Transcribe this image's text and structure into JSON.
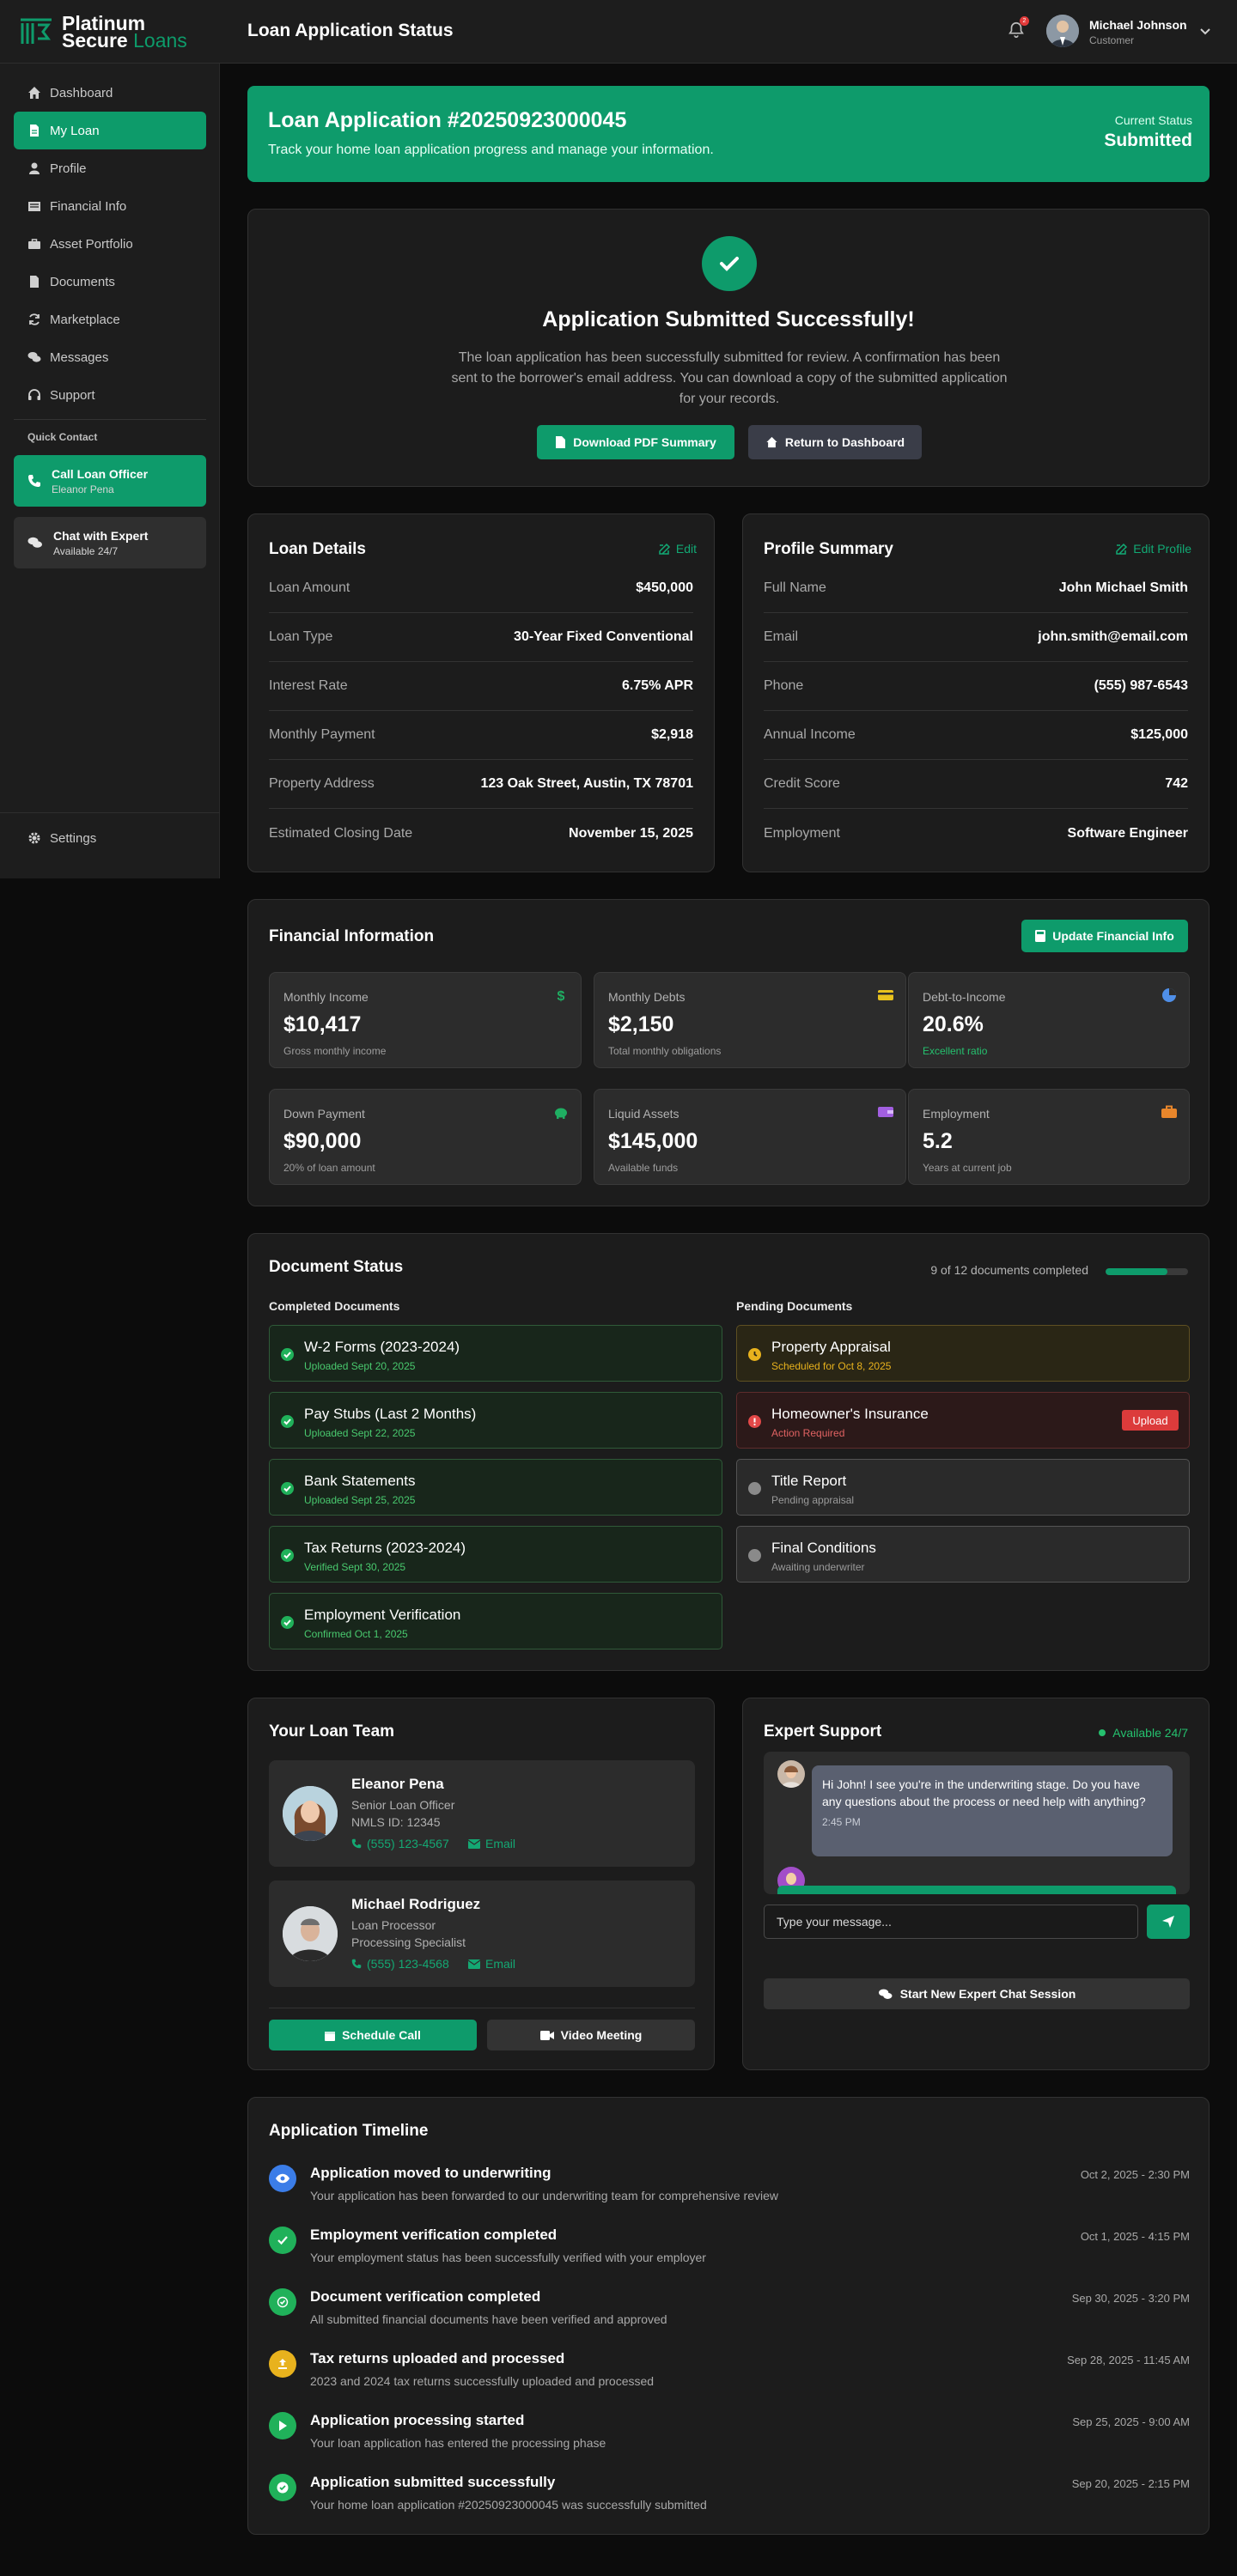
{
  "brand": {
    "line1": "Platinum",
    "line2a": "Secure",
    "line2b": "Loans",
    "accent": "#0e9b6b"
  },
  "header": {
    "title": "Loan Application Status",
    "notification_count": "2",
    "user_name": "Michael Johnson",
    "user_role": "Customer"
  },
  "sidebar": {
    "items": [
      {
        "label": "Dashboard",
        "icon": "home-icon"
      },
      {
        "label": "My Loan",
        "icon": "file-icon"
      },
      {
        "label": "Profile",
        "icon": "user-icon"
      },
      {
        "label": "Financial Info",
        "icon": "building-icon"
      },
      {
        "label": "Asset Portfolio",
        "icon": "briefcase-icon"
      },
      {
        "label": "Documents",
        "icon": "document-icon"
      },
      {
        "label": "Marketplace",
        "icon": "refresh-icon"
      },
      {
        "label": "Messages",
        "icon": "comments-icon"
      },
      {
        "label": "Support",
        "icon": "headset-icon"
      }
    ],
    "quick_contact_label": "Quick Contact",
    "call_officer": {
      "title": "Call Loan Officer",
      "subtitle": "Eleanor Pena"
    },
    "chat_expert": {
      "title": "Chat with Expert",
      "subtitle": "Available 24/7"
    },
    "settings_label": "Settings"
  },
  "banner": {
    "title": "Loan Application #20250923000045",
    "subtitle": "Track your home loan application progress and manage your information.",
    "status_label": "Current Status",
    "status_value": "Submitted"
  },
  "success": {
    "title": "Application Submitted Successfully!",
    "message": "The loan application has been successfully submitted for review. A confirmation has been sent to the borrower's email address. You can download a copy of the submitted application for your records.",
    "download_label": "Download PDF Summary",
    "return_label": "Return to Dashboard"
  },
  "loan_details": {
    "title": "Loan Details",
    "edit_label": "Edit",
    "rows": [
      {
        "k": "Loan Amount",
        "v": "$450,000"
      },
      {
        "k": "Loan Type",
        "v": "30-Year Fixed Conventional"
      },
      {
        "k": "Interest Rate",
        "v": "6.75% APR"
      },
      {
        "k": "Monthly Payment",
        "v": "$2,918"
      },
      {
        "k": "Property Address",
        "v": "123 Oak Street, Austin, TX 78701"
      },
      {
        "k": "Estimated Closing Date",
        "v": "November 15, 2025"
      }
    ]
  },
  "profile_summary": {
    "title": "Profile Summary",
    "edit_label": "Edit Profile",
    "rows": [
      {
        "k": "Full Name",
        "v": "John Michael Smith"
      },
      {
        "k": "Email",
        "v": "john.smith@email.com"
      },
      {
        "k": "Phone",
        "v": "(555) 987-6543"
      },
      {
        "k": "Annual Income",
        "v": "$125,000"
      },
      {
        "k": "Credit Score",
        "v": "742"
      },
      {
        "k": "Employment",
        "v": "Software Engineer"
      }
    ]
  },
  "financial": {
    "title": "Financial Information",
    "update_label": "Update Financial Info",
    "stats": [
      {
        "label": "Monthly Income",
        "value": "$10,417",
        "sub": "Gross monthly income",
        "icon": "dollar-icon",
        "color": "#1fae62"
      },
      {
        "label": "Monthly Debts",
        "value": "$2,150",
        "sub": "Total monthly obligations",
        "icon": "credit-card-icon",
        "color": "#e8c21d"
      },
      {
        "label": "Debt-to-Income",
        "value": "20.6%",
        "sub": "Excellent ratio",
        "icon": "pie-chart-icon",
        "color": "#4f8fe8"
      },
      {
        "label": "Down Payment",
        "value": "$90,000",
        "sub": "20% of loan amount",
        "icon": "piggy-bank-icon",
        "color": "#1fae62"
      },
      {
        "label": "Liquid Assets",
        "value": "$145,000",
        "sub": "Available funds",
        "icon": "wallet-icon",
        "color": "#a25fe0"
      },
      {
        "label": "Employment",
        "value": "5.2",
        "sub": "Years at current job",
        "icon": "briefcase-icon",
        "color": "#e8862b"
      }
    ]
  },
  "documents": {
    "title": "Document Status",
    "progress_text": "9 of 12 documents completed",
    "progress_fraction": 0.75,
    "completed_heading": "Completed Documents",
    "pending_heading": "Pending Documents",
    "completed": [
      {
        "name": "W-2 Forms (2023-2024)",
        "status": "Uploaded Sept 20, 2025"
      },
      {
        "name": "Pay Stubs (Last 2 Months)",
        "status": "Uploaded Sept 22, 2025"
      },
      {
        "name": "Bank Statements",
        "status": "Uploaded Sept 25, 2025"
      },
      {
        "name": "Tax Returns (2023-2024)",
        "status": "Verified Sept 30, 2025"
      },
      {
        "name": "Employment Verification",
        "status": "Confirmed Oct 1, 2025"
      }
    ],
    "pending": [
      {
        "name": "Property Appraisal",
        "status": "Scheduled for Oct 8, 2025",
        "state": "warn"
      },
      {
        "name": "Homeowner's Insurance",
        "status": "Action Required",
        "state": "err",
        "action": "Upload"
      },
      {
        "name": "Title Report",
        "status": "Pending appraisal",
        "state": "pend"
      },
      {
        "name": "Final Conditions",
        "status": "Awaiting underwriter",
        "state": "pend"
      }
    ]
  },
  "team": {
    "title": "Your Loan Team",
    "members": [
      {
        "name": "Eleanor Pena",
        "role": "Senior Loan Officer",
        "detail": "NMLS ID: 12345",
        "phone": "(555) 123-4567",
        "email_label": "Email"
      },
      {
        "name": "Michael Rodriguez",
        "role": "Loan Processor",
        "detail": "Processing Specialist",
        "phone": "(555) 123-4568",
        "email_label": "Email"
      }
    ],
    "schedule_label": "Schedule Call",
    "video_label": "Video Meeting"
  },
  "expert": {
    "title": "Expert Support",
    "availability": "Available 24/7",
    "message": "Hi John! I see you're in the underwriting stage. Do you have any questions about the process or need help with anything?",
    "message_time": "2:45 PM",
    "input_placeholder": "Type your message...",
    "start_label": "Start New Expert Chat Session"
  },
  "timeline": {
    "title": "Application Timeline",
    "events": [
      {
        "title": "Application moved to underwriting",
        "desc": "Your application has been forwarded to our underwriting team for comprehensive review",
        "date": "Oct 2, 2025 - 2:30 PM",
        "color": "#3b7de8",
        "icon": "eye-icon"
      },
      {
        "title": "Employment verification completed",
        "desc": "Your employment status has been successfully verified with your employer",
        "date": "Oct 1, 2025 - 4:15 PM",
        "color": "#20b15a",
        "icon": "check-icon"
      },
      {
        "title": "Document verification completed",
        "desc": "All submitted financial documents have been verified and approved",
        "date": "Sep 30, 2025 - 3:20 PM",
        "color": "#20b15a",
        "icon": "file-check-icon"
      },
      {
        "title": "Tax returns uploaded and processed",
        "desc": "2023 and 2024 tax returns successfully uploaded and processed",
        "date": "Sep 28, 2025 - 11:45 AM",
        "color": "#e8b21d",
        "icon": "upload-icon"
      },
      {
        "title": "Application processing started",
        "desc": "Your loan application has entered the processing phase",
        "date": "Sep 25, 2025 - 9:00 AM",
        "color": "#20b15a",
        "icon": "play-icon"
      },
      {
        "title": "Application submitted successfully",
        "desc": "Your home loan application #20250923000045 was successfully submitted",
        "date": "Sep 20, 2025 - 2:15 PM",
        "color": "#20b15a",
        "icon": "check-circle-icon"
      }
    ]
  }
}
